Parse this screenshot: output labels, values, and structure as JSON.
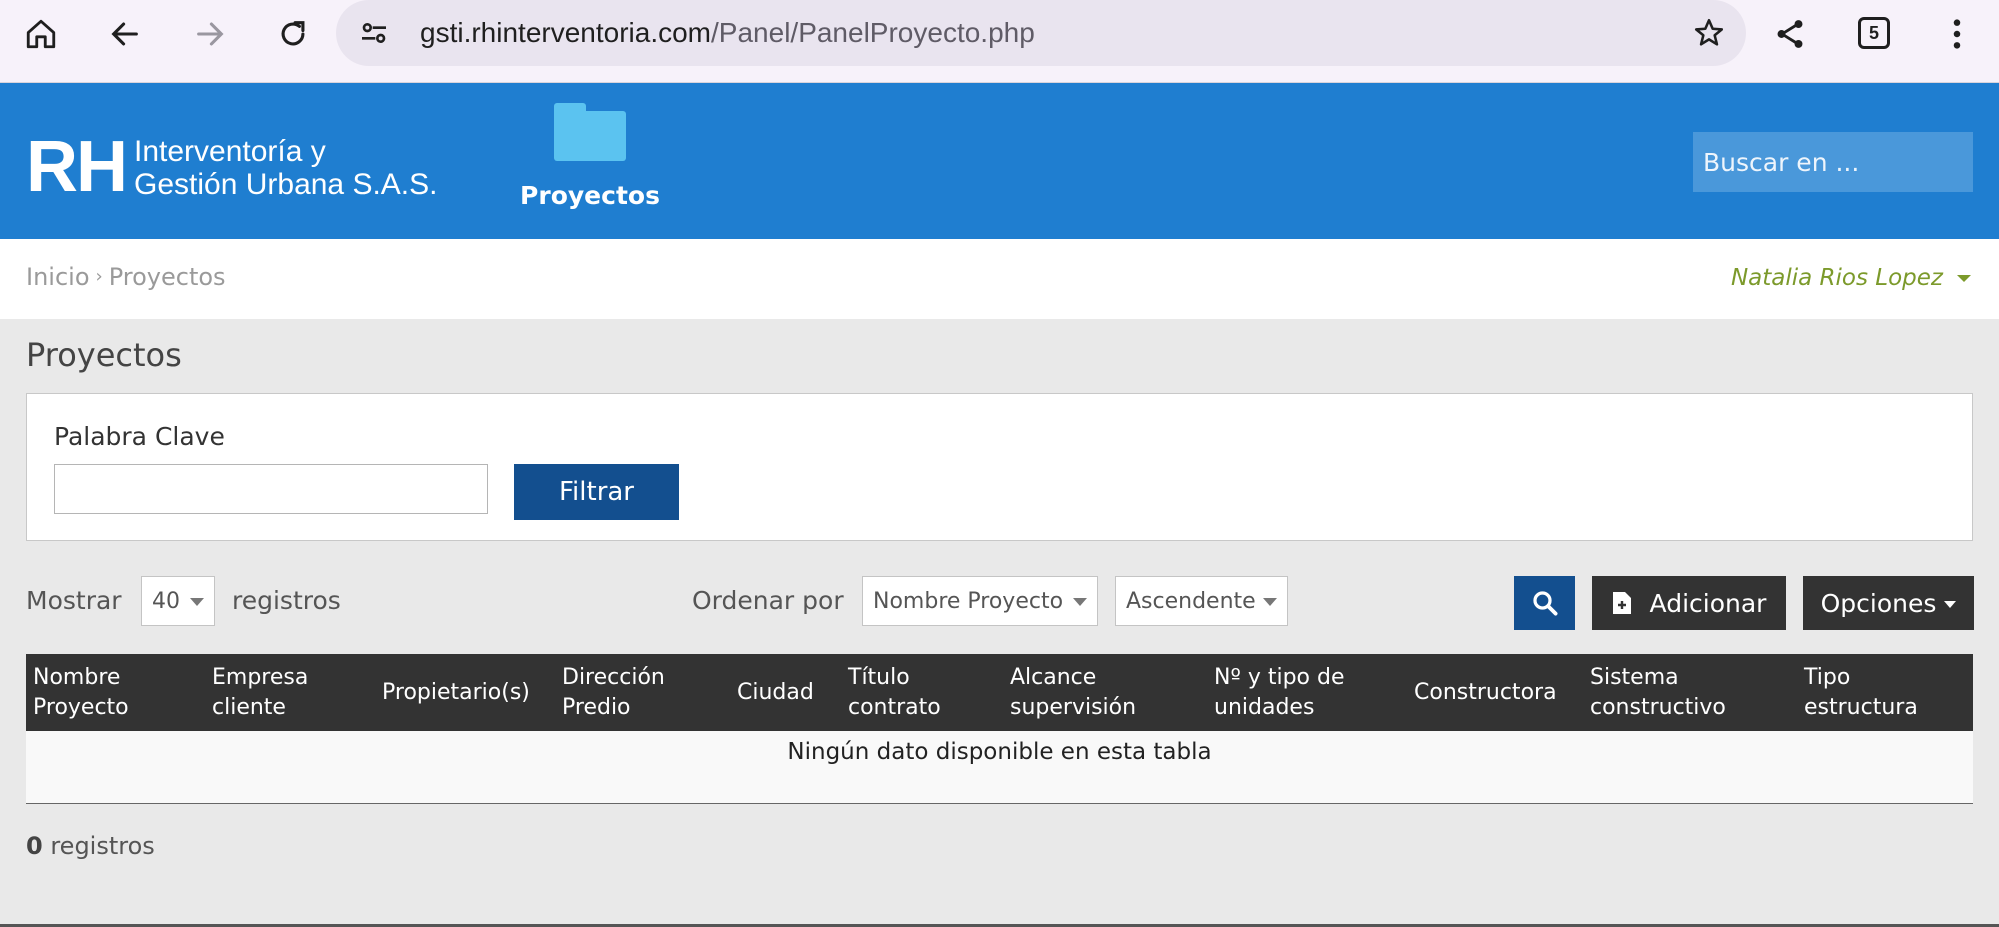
{
  "browser": {
    "url_host": "gsti.rhinterventoria.com",
    "url_path": "/Panel/PanelProyecto.php",
    "tab_count": "5"
  },
  "header": {
    "logo_mark": "RH",
    "logo_line1": "Interventoría y",
    "logo_line2": "Gestión Urbana S.A.S.",
    "nav_projects": "Proyectos",
    "search_placeholder": "Buscar en ..."
  },
  "breadcrumb": {
    "home": "Inicio",
    "separator": "›",
    "current": "Proyectos"
  },
  "user": {
    "name": "Natalia Rios Lopez"
  },
  "page": {
    "title": "Proyectos"
  },
  "filter": {
    "label": "Palabra Clave",
    "value": "",
    "button": "Filtrar"
  },
  "controls": {
    "show_label": "Mostrar",
    "show_value": "40",
    "records_label": "registros",
    "order_label": "Ordenar por",
    "order_field": "Nombre Proyecto",
    "order_direction": "Ascendente",
    "add_button": "Adicionar",
    "options_button": "Opciones"
  },
  "table": {
    "columns": [
      [
        "Nombre",
        "Proyecto"
      ],
      [
        "Empresa",
        "cliente"
      ],
      [
        "Propietario(s)"
      ],
      [
        "Dirección",
        "Predio"
      ],
      [
        "Ciudad"
      ],
      [
        "Título",
        "contrato"
      ],
      [
        "Alcance",
        "supervisión"
      ],
      [
        "Nº y tipo de",
        "unidades"
      ],
      [
        "Constructora"
      ],
      [
        "Sistema",
        "constructivo"
      ],
      [
        "Tipo",
        "estructura"
      ]
    ],
    "empty_message": "Ningún dato disponible en esta tabla"
  },
  "footer": {
    "count": "0",
    "count_label": "registros"
  },
  "colors": {
    "header_blue": "#1f7ed0",
    "button_blue": "#134f8f",
    "dark_button": "#333333",
    "user_green": "#7c9a2b"
  }
}
